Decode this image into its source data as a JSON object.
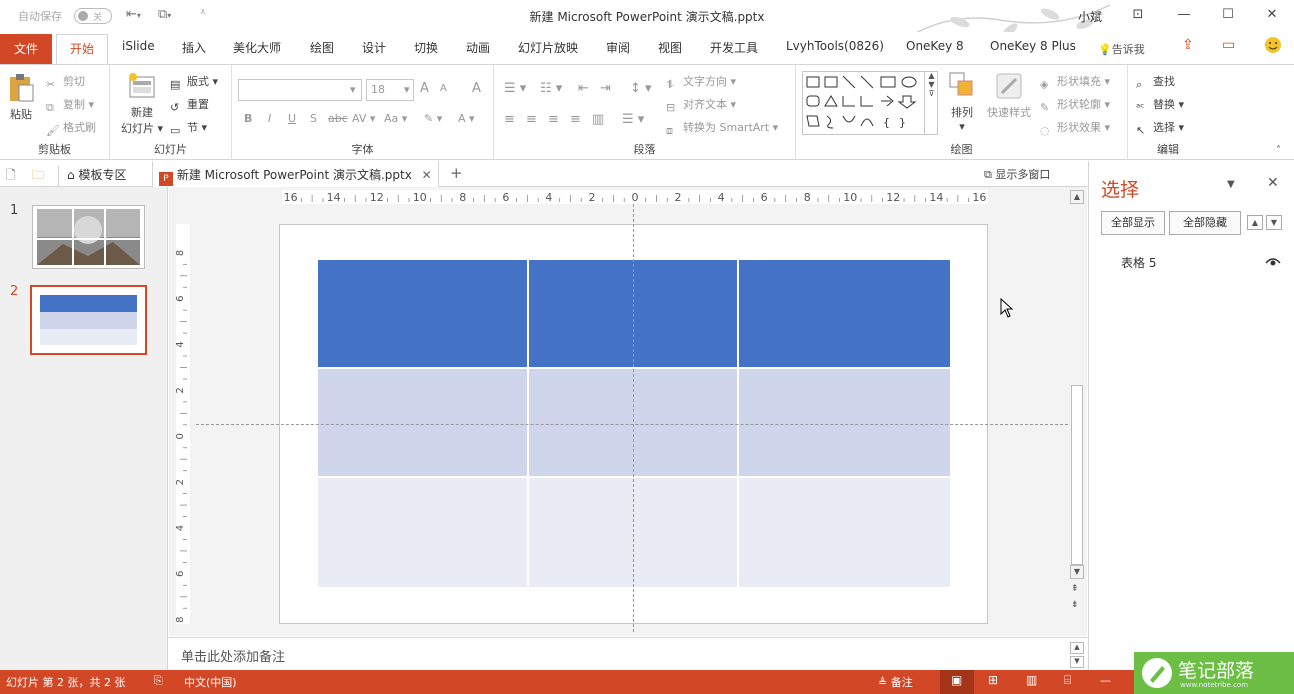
{
  "titlebar": {
    "autosave_label": "自动保存",
    "autosave_state": "关",
    "doc_title": "新建 Microsoft PowerPoint 演示文稿.pptx",
    "user": "小斌",
    "accent": "#d24726"
  },
  "tabs": {
    "file": "文件",
    "active": "开始",
    "items": [
      "iSlide",
      "插入",
      "美化大师",
      "绘图",
      "设计",
      "切换",
      "动画",
      "幻灯片放映",
      "审阅",
      "视图",
      "开发工具",
      "LvyhTools(0826)",
      "OneKey 8",
      "OneKey 8 Plus"
    ],
    "tell_me": "告诉我"
  },
  "ribbon": {
    "clipboard": {
      "label": "剪贴板",
      "paste": "粘贴",
      "cut": "剪切",
      "copy": "复制",
      "format_painter": "格式刷"
    },
    "slides": {
      "label": "幻灯片",
      "new_slide_1": "新建",
      "new_slide_2": "幻灯片",
      "layout": "版式",
      "reset": "重置",
      "section": "节"
    },
    "font": {
      "label": "字体",
      "font_name": "",
      "font_size": "18",
      "bold": "B",
      "italic": "I",
      "underline": "U",
      "shadow": "S",
      "strike": "abc",
      "spacing": "AV",
      "case": "Aa",
      "grow": "A",
      "shrink": "A",
      "clear": "A",
      "color": "A"
    },
    "paragraph": {
      "label": "段落",
      "text_direction": "文字方向",
      "align_text": "对齐文本",
      "convert_smartart": "转换为 SmartArt"
    },
    "drawing": {
      "label": "绘图",
      "arrange": "排列",
      "quick_styles": "快速样式",
      "shape_fill": "形状填充",
      "shape_outline": "形状轮廓",
      "shape_effects": "形状效果"
    },
    "editing": {
      "label": "编辑",
      "find": "查找",
      "replace": "替换",
      "select": "选择"
    }
  },
  "doc_tabs": {
    "template_zone": "模板专区",
    "file_tab": "新建 Microsoft PowerPoint 演示文稿.pptx",
    "multi_window": "显示多窗口"
  },
  "thumbnails": [
    {
      "number": "1"
    },
    {
      "number": "2"
    }
  ],
  "ruler": {
    "h_ticks": [
      "16",
      "14",
      "12",
      "10",
      "8",
      "6",
      "4",
      "2",
      "0",
      "2",
      "4",
      "6",
      "8",
      "10",
      "12",
      "14",
      "16"
    ],
    "v_ticks": [
      "8",
      "6",
      "4",
      "2",
      "0",
      "2",
      "4",
      "6",
      "8"
    ]
  },
  "table": {
    "header_color": "#4472c4",
    "band1_color": "#cfd5ea",
    "band2_color": "#e9ebf5",
    "rows": 3,
    "cols": 3
  },
  "notes": {
    "placeholder": "单击此处添加备注"
  },
  "selection_pane": {
    "title": "选择",
    "show_all": "全部显示",
    "hide_all": "全部隐藏",
    "items": [
      "表格 5"
    ]
  },
  "status": {
    "slide_info": "幻灯片 第 2 张，共 2 张",
    "language": "中文(中国)",
    "notes": "备注"
  },
  "watermark": {
    "text": "笔记部落",
    "url": "www.notetribe.com"
  }
}
